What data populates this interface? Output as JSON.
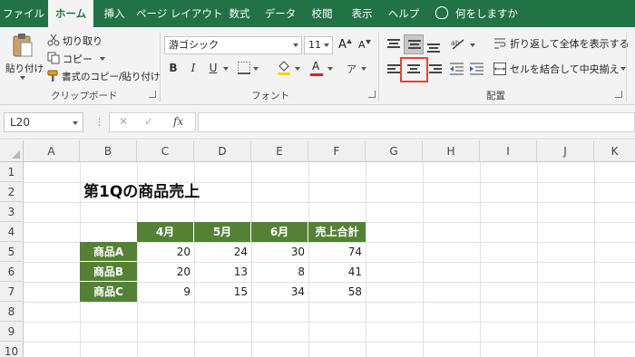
{
  "ribbon_tabs": [
    "ファイル",
    "ホーム",
    "挿入",
    "ページ レイアウト",
    "数式",
    "データ",
    "校閲",
    "表示",
    "ヘルプ"
  ],
  "tell_me": "何をしますか",
  "clipboard": {
    "paste": "貼り付け",
    "cut": "切り取り",
    "copy": "コピー",
    "format_painter": "書式のコピー/貼り付け",
    "group_label": "クリップボード"
  },
  "font": {
    "name": "游ゴシック",
    "size": "11",
    "grow": "A",
    "shrink": "A",
    "bold": "B",
    "italic": "I",
    "underline": "U",
    "font_color": "A",
    "group_label": "フォント"
  },
  "alignment": {
    "wrap_text": "折り返して全体を表示する",
    "merge_center": "セルを結合して中央揃え",
    "group_label": "配置"
  },
  "formula_bar": {
    "name_box": "L20",
    "cancel": "✕",
    "enter": "✓",
    "fx": "fx",
    "formula": ""
  },
  "sheet": {
    "columns": [
      "A",
      "B",
      "C",
      "D",
      "E",
      "F",
      "G",
      "H",
      "I",
      "J",
      "K"
    ],
    "rows": [
      "1",
      "2",
      "3",
      "4",
      "5",
      "6",
      "7",
      "8",
      "9",
      "10"
    ],
    "title": "第1Qの商品売上",
    "table_headers": [
      "4月",
      "5月",
      "6月",
      "売上合計"
    ],
    "table_rows": [
      {
        "label": "商品A",
        "values": [
          "20",
          "24",
          "30",
          "74"
        ]
      },
      {
        "label": "商品B",
        "values": [
          "20",
          "13",
          "8",
          "41"
        ]
      },
      {
        "label": "商品C",
        "values": [
          "9",
          "15",
          "34",
          "58"
        ]
      }
    ]
  },
  "colors": {
    "excel_green": "#217346",
    "table_fill": "#548235",
    "highlight": "#e8452c"
  }
}
